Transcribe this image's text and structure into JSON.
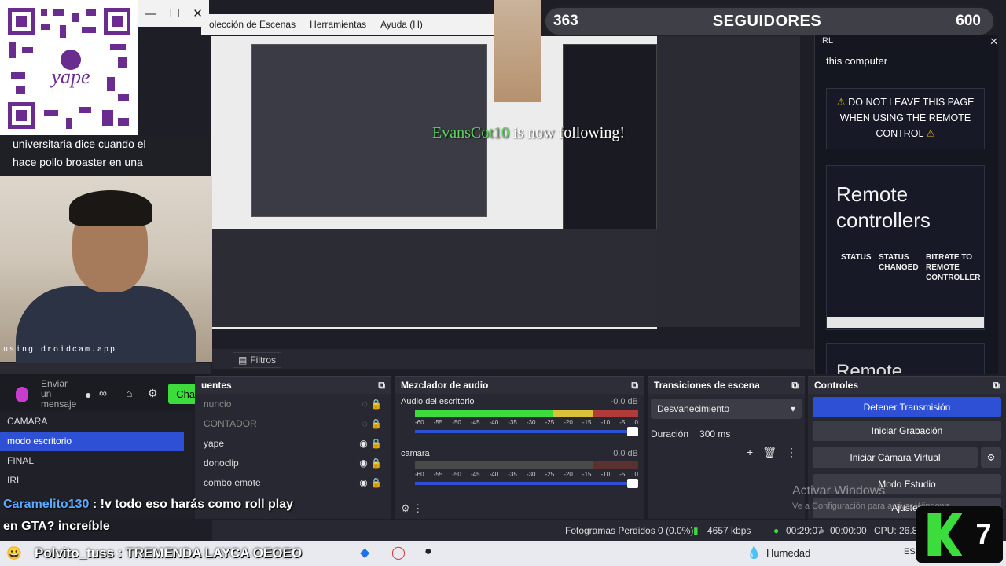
{
  "window": {
    "min_icon": "minimize-icon",
    "max_icon": "maximize-icon",
    "close_icon": "close-icon"
  },
  "menu": [
    "olección de Escenas",
    "Herramientas",
    "Ayuda (H)"
  ],
  "followers": {
    "current": "363",
    "label": "SEGUIDORES",
    "goal": "600"
  },
  "chat_top": {
    "line1": "universitaria dice cuando el",
    "line2": "hace pollo broaster en una"
  },
  "cam_label": "using droidcam.app",
  "chat_input": {
    "placeholder": "Enviar un mensaje",
    "button": "Chat"
  },
  "follow_alert": {
    "name": "EvansCot10",
    "text": " is now following!"
  },
  "irl": {
    "title": "IRL",
    "computer": "this computer",
    "warning": "DO NOT LEAVE THIS PAGE WHEN USING THE REMOTE CONTROL",
    "rc_title": "Remote controllers",
    "col_status": "STATUS",
    "col_changed": "STATUS CHANGED",
    "col_bitrate": "BITRATE TO REMOTE CONTROLLER",
    "rc2_title": "Remote"
  },
  "filters_label": "Filtros",
  "scenes": [
    "CAMARA",
    "modo escritorio",
    "FINAL",
    "IRL"
  ],
  "scenes_selected": 1,
  "sources": {
    "title": "uentes",
    "items": [
      {
        "name": "nuncio",
        "dim": true
      },
      {
        "name": "CONTADOR",
        "dim": true
      },
      {
        "name": "yape",
        "dim": false
      },
      {
        "name": "donoclip",
        "dim": false
      },
      {
        "name": "combo emote",
        "dim": false
      }
    ]
  },
  "mixer": {
    "title": "Mezclador de audio",
    "tracks": [
      {
        "name": "Audio del escritorio",
        "db": "-0.0 dB",
        "level": 1.0
      },
      {
        "name": "camara",
        "db": "0.0 dB",
        "level": 1.0
      }
    ],
    "ticks": [
      "-60",
      "-55",
      "-50",
      "-45",
      "-40",
      "-35",
      "-30",
      "-25",
      "-20",
      "-15",
      "-10",
      "-5",
      "0"
    ]
  },
  "transitions": {
    "title": "Transiciones de escena",
    "selected": "Desvanecimiento",
    "duration_label": "Duración",
    "duration": "300 ms"
  },
  "controls": {
    "title": "Controles",
    "buttons": [
      "Detener Transmisión",
      "Iniciar Grabación",
      "Iniciar Cámara Virtual",
      "Modo Estudio",
      "Ajustes"
    ]
  },
  "status": {
    "frames": "Fotogramas Perdidos 0 (0.0%)",
    "kbps": "4657 kbps",
    "live_time": "00:29:07",
    "rec_time": "00:00:00",
    "cpu": "CPU: 26.8"
  },
  "activate": {
    "title": "Activar Windows",
    "sub": "Ve a Configuración para activar Windows."
  },
  "chat_overlay": {
    "user": "Caramelito130",
    "msg": " : !v todo eso harás como roll play",
    "line2": "en GTA? increíble"
  },
  "taskbar": {
    "ticker": "Polvito_tuss : TREMENDA LAYCA OEOEO",
    "weather": "Humedad",
    "lang": "ES"
  },
  "k7": {
    "num": "7"
  },
  "colors": {
    "accent": "#2e50d4",
    "green": "#3ddc3d",
    "bg": "#1e1f26"
  }
}
